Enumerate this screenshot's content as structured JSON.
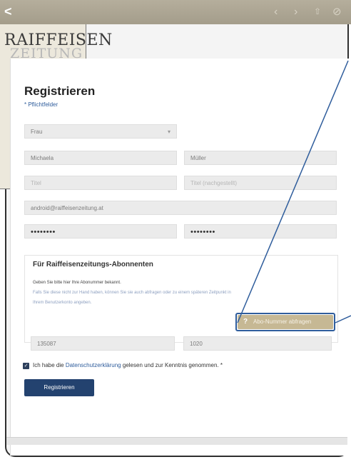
{
  "browser": {
    "back_glyph": "<",
    "icons": [
      "chevron-left-icon",
      "chevron-right-icon",
      "share-icon",
      "close-icon"
    ],
    "bar_color": "#a9a290"
  },
  "brand": {
    "logo_line1": "RAIFFEISEN",
    "logo_line2": "ZEITUNG"
  },
  "form": {
    "title": "Registrieren",
    "required_note": "* Pflichtfelder",
    "salutation": "Frau",
    "first_name": "Michaela",
    "last_name": "Müller",
    "title_placeholder": "Titel",
    "title_after_placeholder": "Titel (nachgestellt)",
    "email": "android@raiffeisenzeitung.at",
    "password": "••••••••",
    "password_repeat": "••••••••"
  },
  "subscribers": {
    "heading": "Für Raiffeisenzeitungs-Abonnenten",
    "line1": "Geben Sie bitte hier Ihre Abonummer bekannt.",
    "line2": "Falls Sie diese nicht zur Hand haben, können Sie sie auch abfragen oder zu einem späteren Zeitpunkt in",
    "line3": "Ihrem Benutzerkonto angeben.",
    "abo_button": "Abo-Nummer abfragen",
    "abo_number": "135087",
    "postal_code": "1020"
  },
  "consent": {
    "text_before": "Ich habe die ",
    "link": "Datenschutzerklärung",
    "text_after": " gelesen und zur Kenntnis genommen. *"
  },
  "submit_label": "Registrieren",
  "colors": {
    "accent": "#23426f",
    "link": "#2f5d9c",
    "abo_button": "#c6b894",
    "field_bg": "#ebebeb"
  }
}
